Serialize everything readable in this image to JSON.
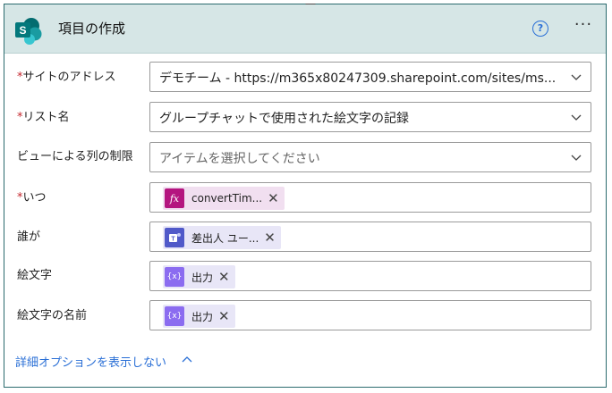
{
  "header": {
    "title": "項目の作成",
    "icon": "sharepoint-icon",
    "help": "?",
    "more": "···"
  },
  "fields": [
    {
      "label": "サイトのアドレス",
      "required": true,
      "value": "デモチーム - https://m365x80247309.sharepoint.com/sites/ms...",
      "type": "dropdown"
    },
    {
      "label": "リスト名",
      "required": true,
      "value": "グループチャットで使用された絵文字の記録",
      "type": "dropdown"
    },
    {
      "label": "ビューによる列の制限",
      "required": false,
      "placeholder": "アイテムを選択してください",
      "type": "dropdown"
    },
    {
      "label": "いつ",
      "required": true,
      "token": {
        "label": "convertTim...",
        "icon": "fx-icon"
      }
    },
    {
      "label": "誰が",
      "required": false,
      "token": {
        "label": "差出人 ユー...",
        "icon": "teams-icon"
      }
    },
    {
      "label": "絵文字",
      "required": false,
      "token": {
        "label": "出力",
        "icon": "variable-icon"
      }
    },
    {
      "label": "絵文字の名前",
      "required": false,
      "token": {
        "label": "出力",
        "icon": "variable-icon"
      }
    }
  ],
  "advanced_toggle": "詳細オプションを表示しない",
  "colors": {
    "header_bg": "#d6e6e6",
    "required": "#c4252c",
    "link": "#2a6fd6",
    "fx_token": "#b4157f",
    "teams_token": "#5059c9",
    "variable_token": "#8b6cf0"
  }
}
